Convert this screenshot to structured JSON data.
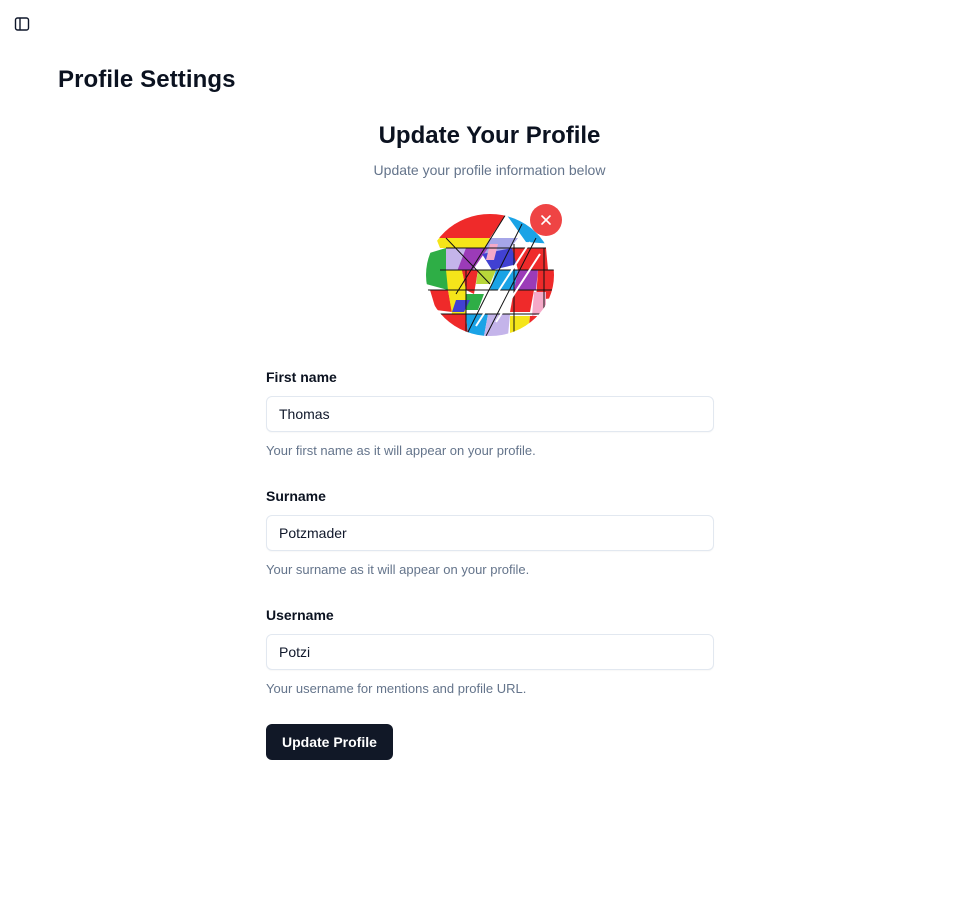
{
  "sidebar_toggle": {
    "icon": "sidebar-toggle-icon"
  },
  "page": {
    "title": "Profile Settings"
  },
  "profile_form": {
    "title": "Update Your Profile",
    "subtitle": "Update your profile information below",
    "avatar": {
      "remove_icon": "close-icon",
      "remove_color": "#ef4444"
    },
    "fields": {
      "first_name": {
        "label": "First name",
        "value": "Thomas",
        "help": "Your first name as it will appear on your profile."
      },
      "surname": {
        "label": "Surname",
        "value": "Potzmader",
        "help": "Your surname as it will appear on your profile."
      },
      "username": {
        "label": "Username",
        "value": "Potzi",
        "help": "Your username for mentions and profile URL."
      }
    },
    "submit_label": "Update Profile"
  },
  "colors": {
    "primary_button": "#111827",
    "muted_text": "#64748b",
    "border": "#e2e8f0",
    "danger": "#ef4444"
  }
}
